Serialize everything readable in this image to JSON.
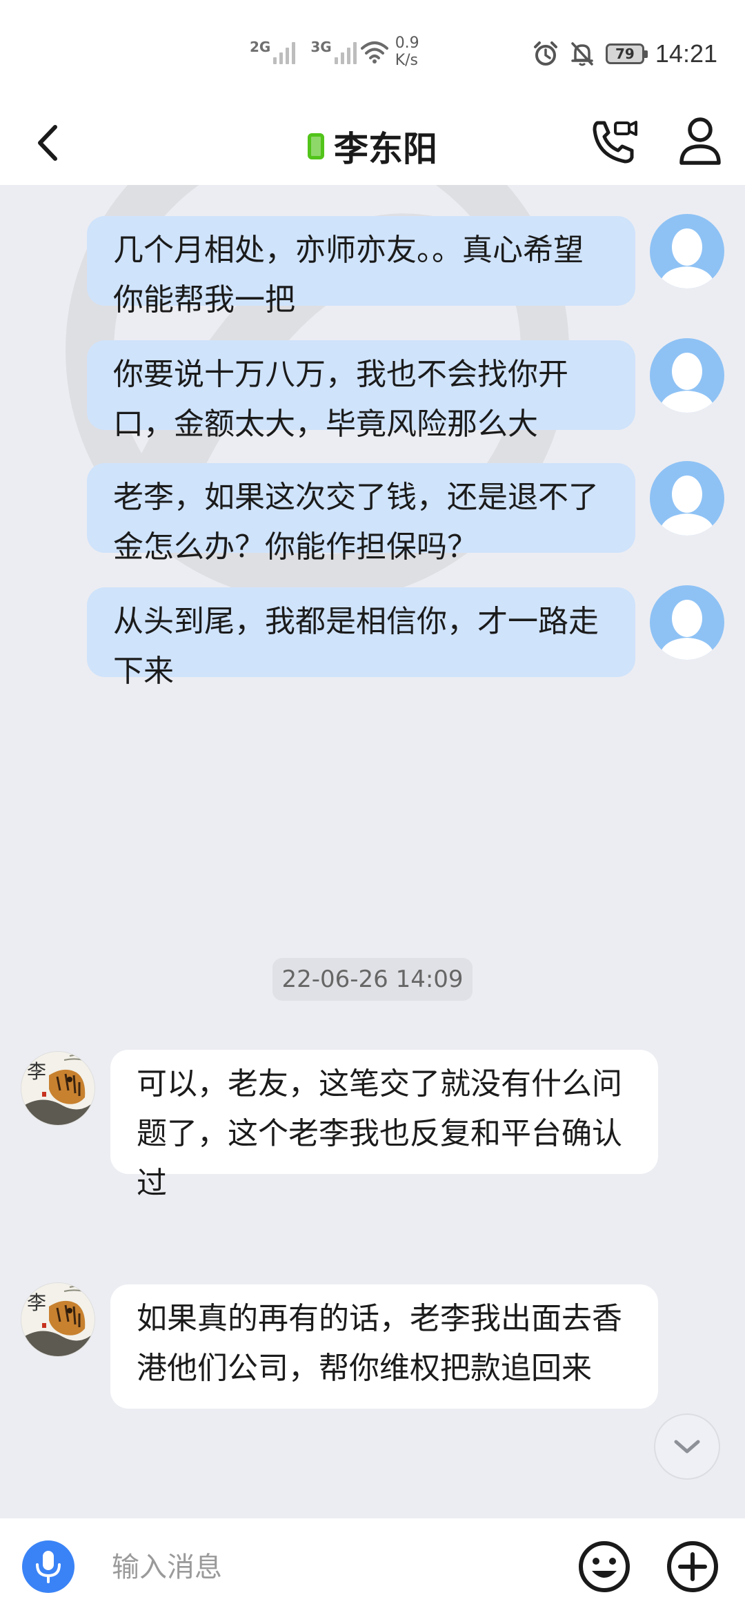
{
  "status_bar": {
    "net1": "2G",
    "net2": "3G",
    "speed_value": "0.9",
    "speed_unit": "K/s",
    "battery": "79",
    "time": "14:21"
  },
  "header": {
    "title": "李东阳",
    "icons": [
      "back-arrow-icon",
      "phone-device-icon",
      "video-call-icon",
      "person-icon"
    ]
  },
  "messages": [
    {
      "side": "out",
      "text": "几个月相处，亦师亦友。。真心希望你能帮我一把"
    },
    {
      "side": "out",
      "text": "你要说十万八万，我也不会找你开口，金额太大，毕竟风险那么大"
    },
    {
      "side": "out",
      "text": "老李，如果这次交了钱，还是退不了金怎么办？你能作担保吗？"
    },
    {
      "side": "out",
      "text": "从头到尾，我都是相信你，才一路走下来"
    },
    {
      "side": "in",
      "text": "可以，老友，这笔交了就没有什么问题了，这个老李我也反复和平台确认过"
    },
    {
      "side": "in",
      "text": "如果真的再有的话，老李我出面去香港他们公司，帮你维权把款追回来"
    }
  ],
  "timestamp": "22-06-26 14:09",
  "peer_avatar_char": "李",
  "input": {
    "placeholder": "输入消息"
  },
  "colors": {
    "outgoing_bubble": "#cfe3fb",
    "incoming_bubble": "#ffffff",
    "chat_bg": "#ecedf2",
    "accent": "#3a83f6",
    "online_green": "#52c41a"
  }
}
